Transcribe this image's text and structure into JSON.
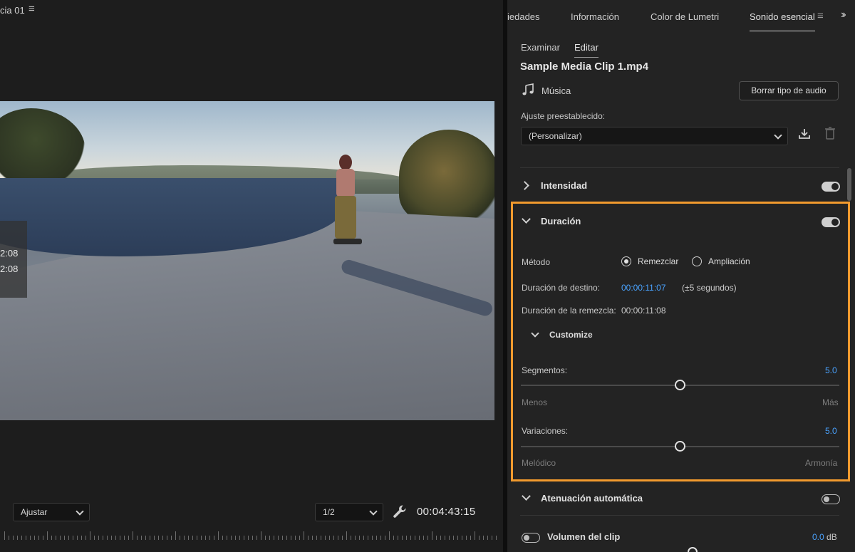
{
  "monitor": {
    "title": "cia 01",
    "menu_icon": "hamburger-icon",
    "overlay_timecodes": [
      "2:08",
      "2:08"
    ],
    "zoom_select": "Ajustar",
    "resolution_select": "1/2",
    "timecode": "00:04:43:15",
    "settings_icon": "wrench-icon"
  },
  "panel": {
    "tabs": [
      "iedades",
      "Información",
      "Color de Lumetri",
      "Sonido esencial"
    ],
    "active_tab": "Sonido esencial",
    "subtabs": [
      "Examinar",
      "Editar"
    ],
    "active_subtab": "Editar",
    "clip_name": "Sample Media Clip 1.mp4",
    "audio_type": "Música",
    "clear_button": "Borrar tipo de audio",
    "preset_label": "Ajuste preestablecido:",
    "preset_value": "(Personalizar)",
    "sections": {
      "intensity": {
        "title": "Intensidad",
        "enabled": true,
        "expanded": false
      },
      "duration": {
        "title": "Duración",
        "enabled": true,
        "expanded": true,
        "method_label": "Método",
        "methods": [
          "Remezclar",
          "Ampliación"
        ],
        "selected_method": "Remezclar",
        "target_label": "Duración de destino:",
        "target_value": "00:00:11:07",
        "target_tolerance": "(±5 segundos)",
        "remix_label": "Duración de la remezcla:",
        "remix_value": "00:00:11:08",
        "customize_label": "Customize",
        "segments": {
          "label": "Segmentos:",
          "value": "5.0",
          "min_label": "Menos",
          "max_label": "Más",
          "level": 0.5
        },
        "variations": {
          "label": "Variaciones:",
          "value": "5.0",
          "min_label": "Melódico",
          "max_label": "Armonía",
          "level": 0.5
        }
      },
      "ducking": {
        "title": "Atenuación automática",
        "enabled": false,
        "expanded": true
      }
    },
    "clip_volume": {
      "label": "Volumen del clip",
      "value": "0.0",
      "unit": "dB",
      "enabled": false
    }
  },
  "colors": {
    "highlight": "#f29a2e",
    "accent_blue": "#4aa3ff"
  }
}
